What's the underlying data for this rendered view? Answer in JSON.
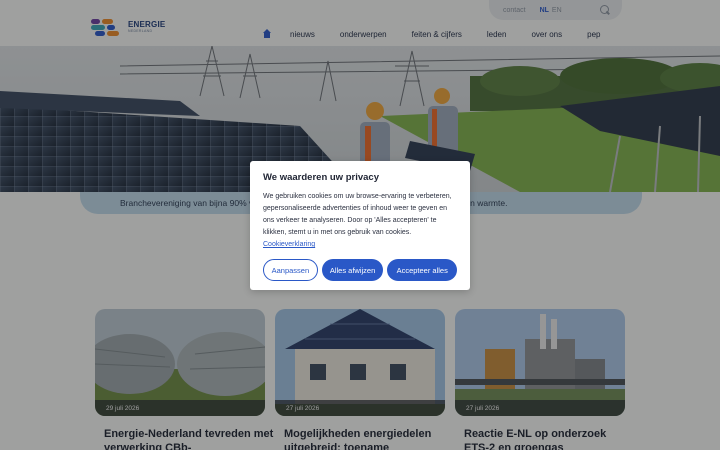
{
  "utility": {
    "contact": "contact",
    "lang_nl": "NL",
    "lang_en": "EN"
  },
  "logo": {
    "line1": "ENERGIE",
    "line2": "NEDERLAND"
  },
  "nav": {
    "items": [
      "nieuws",
      "onderwerpen",
      "feiten & cijfers",
      "leden",
      "over ons",
      "pep"
    ]
  },
  "tagline": "Branchevereniging van bijna 90% van de productie, handel en levering van elektriciteit, gas en warmte.",
  "cookie": {
    "title": "We waarderen uw privacy",
    "body": "We gebruiken cookies om uw browse-ervaring te verbeteren, gepersonaliseerde advertenties of inhoud weer te geven en ons verkeer te analyseren. Door op 'Alles accepteren' te klikken, stemt u in met ons gebruik van cookies.",
    "link": "Cookieverklaring",
    "btn_customize": "Aanpassen",
    "btn_reject": "Alles afwijzen",
    "btn_accept": "Accepteer alles"
  },
  "articles": [
    {
      "date": "29 juli 2026",
      "title": "Energie-Nederland tevreden met verwerking CBb-"
    },
    {
      "date": "27 juli 2026",
      "title": "Mogelijkheden energiedelen uitgebreid: toename"
    },
    {
      "date": "27 juli 2026",
      "title": "Reactie E-NL op onderzoek ETS-2 en groengas"
    }
  ],
  "colors": {
    "accent": "#2a58c7",
    "tagline_bg": "#bcd5e6",
    "logo_purple": "#6b3fa0",
    "logo_orange": "#e8892b",
    "logo_blue": "#2a58c7",
    "logo_teal": "#3aa3b5"
  }
}
